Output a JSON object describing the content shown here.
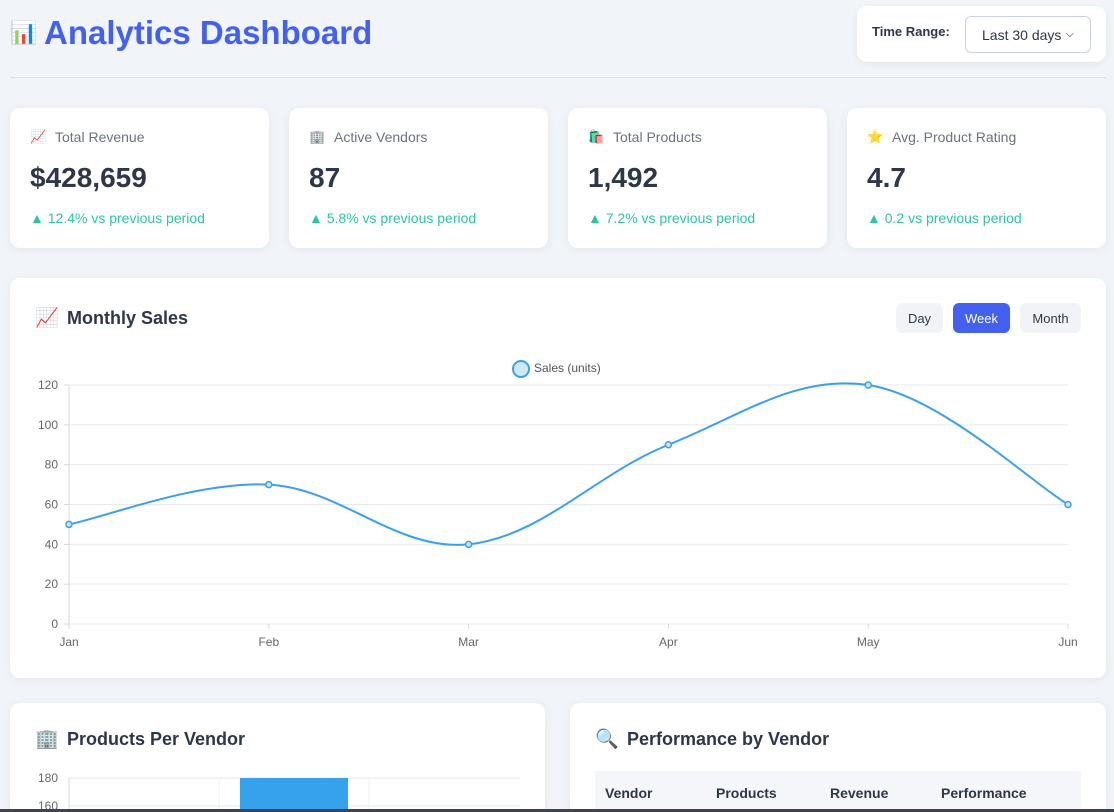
{
  "header": {
    "icon": "bar-chart-icon",
    "title": "Analytics Dashboard",
    "time_range_label": "Time Range:",
    "time_range_value": "Last 30 days"
  },
  "stats": [
    {
      "icon": "chart-up-icon",
      "label": "Total Revenue",
      "value": "$428,659",
      "change": "▲ 12.4% vs previous period"
    },
    {
      "icon": "building-icon",
      "label": "Active Vendors",
      "value": "87",
      "change": "▲ 5.8% vs previous period"
    },
    {
      "icon": "shopping-bags-icon",
      "label": "Total Products",
      "value": "1,492",
      "change": "▲ 7.2% vs previous period"
    },
    {
      "icon": "star-icon",
      "label": "Avg. Product Rating",
      "value": "4.7",
      "change": "▲ 0.2 vs previous period"
    }
  ],
  "monthly_sales": {
    "title": "Monthly Sales",
    "buttons": [
      "Day",
      "Week",
      "Month"
    ],
    "active_button": "Week"
  },
  "products_per_vendor": {
    "title": "Products Per Vendor"
  },
  "performance": {
    "title": "Performance by Vendor",
    "columns": [
      "Vendor",
      "Products",
      "Revenue",
      "Performance"
    ]
  },
  "colors": {
    "accent": "#4361ee",
    "positive": "#2ec4a6",
    "line": "#3aa0e8"
  },
  "chart_data": [
    {
      "type": "line",
      "x": [
        "Jan",
        "Feb",
        "Mar",
        "Apr",
        "May",
        "Jun"
      ],
      "series": [
        {
          "name": "Sales (units)",
          "values": [
            50,
            70,
            40,
            90,
            120,
            60
          ]
        }
      ],
      "ylim": [
        0,
        120
      ],
      "yticks": [
        0,
        20,
        40,
        60,
        80,
        100,
        120
      ],
      "legend": "top-center",
      "grid": true
    },
    {
      "type": "bar",
      "yticks": [
        160,
        180
      ],
      "visible_values": [
        180
      ],
      "grid": true
    }
  ]
}
